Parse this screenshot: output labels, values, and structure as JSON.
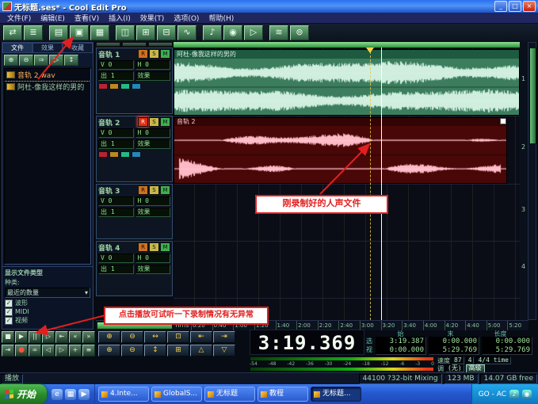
{
  "window": {
    "title": "无标题.ses* - Cool Edit Pro",
    "min": "_",
    "max": "□",
    "close": "×"
  },
  "menu": {
    "items": [
      "文件(F)",
      "编辑(E)",
      "查看(V)",
      "插入(I)",
      "效果(T)",
      "选项(O)",
      "帮助(H)"
    ]
  },
  "toolbar": {
    "buttons": [
      {
        "name": "edit-view-toggle-icon",
        "glyph": "⇄"
      },
      {
        "name": "multitrack-view-icon",
        "glyph": "≣"
      },
      {
        "name": "new-session-icon",
        "glyph": "▤"
      },
      {
        "name": "open-file-icon",
        "glyph": "▣"
      },
      {
        "name": "save-session-icon",
        "glyph": "▦"
      },
      {
        "name": "mixer-icon",
        "glyph": "◫"
      },
      {
        "name": "zoom-in-icon",
        "glyph": "⊞"
      },
      {
        "name": "zoom-out-icon",
        "glyph": "⊟"
      },
      {
        "name": "waveform-icon",
        "glyph": "∿"
      },
      {
        "name": "loop-icon",
        "glyph": "♪"
      },
      {
        "name": "record-icon",
        "glyph": "◉"
      },
      {
        "name": "play-icon",
        "glyph": "▷"
      },
      {
        "name": "spectral-icon",
        "glyph": "≋"
      },
      {
        "name": "settings-icon",
        "glyph": "⊚"
      }
    ]
  },
  "organizer": {
    "tabs": [
      {
        "label": "文件"
      },
      {
        "label": "效果"
      },
      {
        "label": "收藏"
      }
    ],
    "toolbar": [
      {
        "name": "import-file-icon",
        "glyph": "⊕"
      },
      {
        "name": "close-file-icon",
        "glyph": "⊖"
      },
      {
        "name": "insert-multitrack-icon",
        "glyph": "⇒"
      },
      {
        "name": "play-file-icon",
        "glyph": "▷"
      },
      {
        "name": "sort-icon",
        "glyph": "↕"
      }
    ],
    "files": [
      {
        "name": "音轨 2.wav"
      },
      {
        "name": "阿杜-像我这样的男的"
      }
    ],
    "filter": {
      "title": "显示文件类型",
      "kind": "种类:",
      "sort": "最近的数量",
      "dropdown_glyph": "▾",
      "check_glyph": "✓",
      "checks": [
        {
          "label": "波形"
        },
        {
          "label": "MIDI"
        },
        {
          "label": "视频"
        }
      ]
    }
  },
  "trackctl": {
    "rsm": [
      "R",
      "S",
      "M"
    ],
    "vol": "V 0",
    "pan": "H 0",
    "out": "出 1",
    "fx": "效果"
  },
  "tracks": [
    {
      "name": "音轨 1"
    },
    {
      "name": "音轨 2"
    },
    {
      "name": "音轨 3"
    },
    {
      "name": "音轨 4"
    }
  ],
  "clips": {
    "music": "阿杜-像我这样的男的",
    "vocal": "音轨 2"
  },
  "ruler": {
    "unit": "hms",
    "ticks": [
      "0:20",
      "0:40",
      "1:00",
      "1:20",
      "1:40",
      "2:00",
      "2:20",
      "2:40",
      "3:00",
      "3:20",
      "3:40",
      "4:00",
      "4:20",
      "4:40",
      "5:00",
      "5:20"
    ]
  },
  "lanes": [
    "1",
    "2",
    "3",
    "4"
  ],
  "transport": {
    "row1": [
      {
        "name": "stop-button",
        "glyph": "■"
      },
      {
        "name": "play-button",
        "glyph": "▶"
      },
      {
        "name": "pause-button",
        "glyph": "||"
      },
      {
        "name": "play-to-end-button",
        "glyph": "▷"
      },
      {
        "name": "go-start-button",
        "glyph": "⇤"
      },
      {
        "name": "rewind-button",
        "glyph": "«"
      },
      {
        "name": "forward-button",
        "glyph": "»"
      }
    ],
    "row2": [
      {
        "name": "go-end-button",
        "glyph": "⇥"
      },
      {
        "name": "record-button",
        "glyph": "●"
      },
      {
        "name": "loop-button",
        "glyph": "∞"
      },
      {
        "name": "prev-cue-button",
        "glyph": "◁"
      },
      {
        "name": "next-cue-button",
        "glyph": "▷"
      },
      {
        "name": "add-cue-button",
        "glyph": "+"
      },
      {
        "name": "options-button",
        "glyph": "≡"
      }
    ]
  },
  "zoom": {
    "row1": [
      {
        "name": "zoom-in-horizontal-button",
        "glyph": "⊕"
      },
      {
        "name": "zoom-out-horizontal-button",
        "glyph": "⊖"
      },
      {
        "name": "zoom-full-button",
        "glyph": "↔"
      },
      {
        "name": "zoom-selection-button",
        "glyph": "⊡"
      },
      {
        "name": "zoom-left-edge-button",
        "glyph": "⇤"
      },
      {
        "name": "zoom-right-edge-button",
        "glyph": "⇥"
      }
    ],
    "row2": [
      {
        "name": "zoom-in-vertical-button",
        "glyph": "⊕"
      },
      {
        "name": "zoom-out-vertical-button",
        "glyph": "⊖"
      },
      {
        "name": "zoom-height-button",
        "glyph": "↕"
      },
      {
        "name": "zoom-all-button",
        "glyph": "⊞"
      },
      {
        "name": "zoom-up-button",
        "glyph": "△"
      },
      {
        "name": "zoom-down-button",
        "glyph": "▽"
      }
    ]
  },
  "time_display": {
    "value": "3:19.369"
  },
  "selection_grid": {
    "headers": [
      "始",
      "末",
      "长度"
    ],
    "rows": [
      {
        "label": "选",
        "values": [
          "3:19.387",
          "0:00.000",
          "0:00.000"
        ]
      },
      {
        "label": "视",
        "values": [
          "0:00.000",
          "5:29.769",
          "5:29.769"
        ]
      }
    ]
  },
  "tempo": {
    "label": "速度",
    "bpm": "87",
    "beats": "4",
    "sig": "4/4 time",
    "key_label": "调",
    "key": "(无)",
    "advanced": "高级"
  },
  "meter": {
    "scale": [
      "-54",
      "-48",
      "-42",
      "-36",
      "-30",
      "-24",
      "-18",
      "-12",
      "-6",
      "-3",
      "0"
    ]
  },
  "status": {
    "mode": "播放",
    "format": "44100 ?32-bit Mixing",
    "memory": "123 MB",
    "disk": "14.07 GB free"
  },
  "taskbar": {
    "start": "开始",
    "quick": [
      {
        "name": "ie-icon",
        "glyph": "e"
      },
      {
        "name": "show-desktop-icon",
        "glyph": "▦"
      },
      {
        "name": "media-player-icon",
        "glyph": "▶"
      }
    ],
    "tasks": [
      {
        "label": "4.Inte...",
        "active": false
      },
      {
        "label": "GlobalS...",
        "active": false
      },
      {
        "label": "无标题",
        "active": false
      },
      {
        "label": "教程",
        "active": false
      },
      {
        "label": "无标题...",
        "active": true
      }
    ],
    "tray_text": "GO - AC",
    "tray_icons": [
      {
        "name": "volume-icon",
        "glyph": "♪"
      },
      {
        "name": "antivirus-icon",
        "glyph": "◉"
      }
    ]
  },
  "callouts": {
    "vocal": "刚录制好的人声文件",
    "play": "点击播放可试听一下录制情况有无异常"
  }
}
